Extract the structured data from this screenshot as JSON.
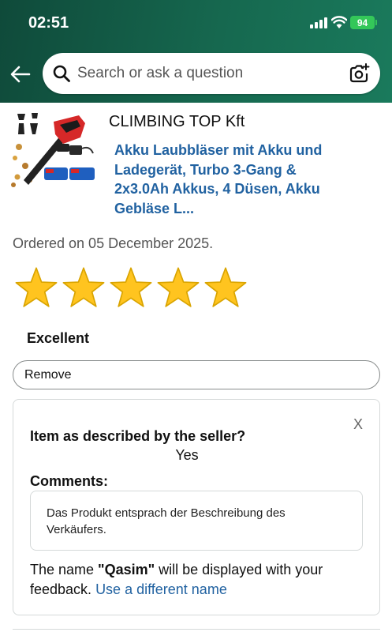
{
  "status_bar": {
    "time": "02:51",
    "battery": "94"
  },
  "search": {
    "placeholder": "Search or ask a question"
  },
  "product": {
    "seller": "CLIMBING TOP Kft",
    "title": "Akku Laubbläser mit Akku und Ladegerät, Turbo 3-Gang & 2x3.0Ah Akkus, 4 Düsen, Akku Gebläse L...",
    "ordered": "Ordered on 05 December 2025."
  },
  "rating": {
    "stars": 5,
    "max_stars": 5,
    "label": "Excellent",
    "remove_label": "Remove",
    "star_color": "#ffc41f"
  },
  "feedback": {
    "close_label": "X",
    "question": "Item as described by the seller?",
    "answer": "Yes",
    "comments_label": "Comments:",
    "comment_text": "Das Produkt entsprach der Beschreibung des Verkäufers.",
    "name_prefix": "The name ",
    "name": "\"Qasim\"",
    "name_suffix": " will be displayed with your feedback. ",
    "change_name_link": "Use a different name"
  },
  "colors": {
    "header": "#16684f",
    "link": "#2162a1",
    "battery": "#34c759"
  },
  "icons": [
    "back-arrow-icon",
    "search-icon",
    "camera-icon",
    "star-icon",
    "signal-icon",
    "wifi-icon"
  ]
}
